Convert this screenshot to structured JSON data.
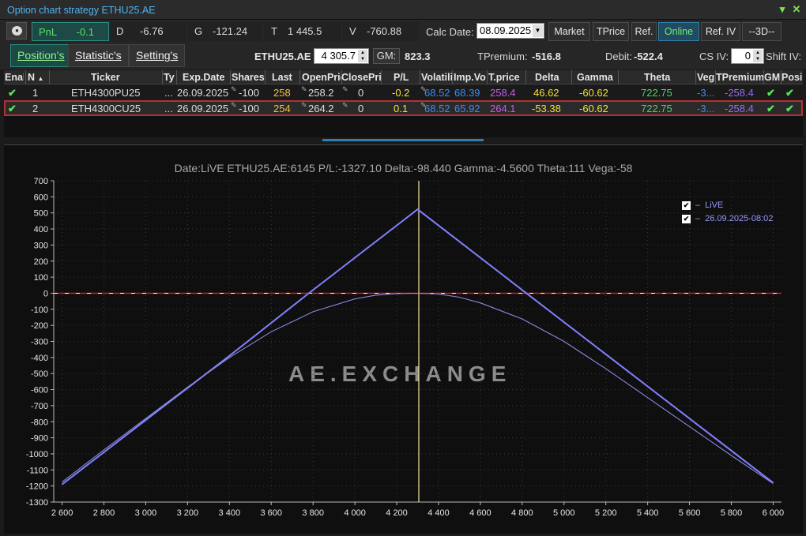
{
  "window": {
    "title": "Option chart strategy ETHU25.AE"
  },
  "row1": {
    "pnl_label": "PnL",
    "pnl_value": "-0.1",
    "d_label": "D",
    "d_value": "-6.76",
    "g_label": "G",
    "g_value": "-121.24",
    "t_label": "T",
    "t_value": "1 445.5",
    "v_label": "V",
    "v_value": "-760.88",
    "calc_label": "Calc Date:",
    "calc_date": "08.09.2025",
    "buttons": [
      "Market",
      "TPrice",
      "Ref.",
      "Online",
      "Ref. IV",
      "--3D--"
    ]
  },
  "row2": {
    "tabs": [
      "Position's",
      "Statistic's",
      "Setting's"
    ],
    "underlying": "ETHU25.AE",
    "underlying_price": "4 305.7",
    "gm_label": "GM:",
    "gm_value": "823.3",
    "tpremium_label": "TPremium:",
    "tpremium_value": "-516.8",
    "debit_label": "Debit:",
    "debit_value": "-522.4",
    "csiv_label": "CS IV:",
    "csiv_value": "0",
    "shiftiv_label": "Shift IV:"
  },
  "grid": {
    "headers": [
      "Enal",
      "N",
      "Ticker",
      "Ty",
      "Exp.Date",
      "Shares",
      "Last",
      "OpenPric",
      "ClosePri",
      "P/L",
      "Volatili",
      "Imp.Vo",
      "T.price",
      "Delta",
      "Gamma",
      "Theta",
      "Veg",
      "TPremium",
      "GM",
      "Posi"
    ],
    "rows": [
      {
        "n": "1",
        "ticker": "ETH4300PU25",
        "ty": "...",
        "exp": "26.09.2025",
        "shares": "-100",
        "last": "258",
        "open": "258.2",
        "close": "0",
        "pl": "-0.2",
        "vol": "68.52",
        "impvol": "68.39",
        "tprice": "258.4",
        "delta": "46.62",
        "gamma": "-60.62",
        "theta": "722.75",
        "vega": "-3...",
        "tpremium": "-258.4"
      },
      {
        "n": "2",
        "ticker": "ETH4300CU25",
        "ty": "...",
        "exp": "26.09.2025",
        "shares": "-100",
        "last": "254",
        "open": "264.2",
        "close": "0",
        "pl": "0.1",
        "vol": "68.52",
        "impvol": "65.92",
        "tprice": "264.1",
        "delta": "-53.38",
        "gamma": "-60.62",
        "theta": "722.75",
        "vega": "-3...",
        "tpremium": "-258.4"
      }
    ]
  },
  "chart": {
    "title": "Date:LiVE  ETHU25.AE:6145  P/L:-1327.10  Delta:-98.440  Gamma:-4.5600  Theta:111  Vega:-58",
    "watermark": "AE.EXCHANGE",
    "legend": [
      "LiVE",
      "26.09.2025-08:02"
    ]
  },
  "chart_data": {
    "type": "line",
    "x_ticks": [
      2600,
      2800,
      3000,
      3200,
      3400,
      3600,
      3800,
      4000,
      4200,
      4400,
      4600,
      4800,
      5000,
      5200,
      5400,
      5600,
      5800,
      6000
    ],
    "y_ticks": [
      700,
      600,
      500,
      400,
      300,
      200,
      100,
      0,
      -100,
      -200,
      -300,
      -400,
      -500,
      -600,
      -700,
      -800,
      -900,
      -1000,
      -1100,
      -1200,
      -1300
    ],
    "xlim": [
      2560,
      6040
    ],
    "ylim": [
      -1300,
      700
    ],
    "strike": 4300,
    "current_price": 4305.7,
    "series": [
      {
        "name": "26.09.2025-08:02",
        "color": "#8080ff",
        "x": [
          2600,
          3000,
          3400,
          3780,
          4300,
          4820,
          5200,
          5600,
          6000
        ],
        "y": [
          -1190,
          -790,
          -390,
          0,
          522,
          0,
          -380,
          -780,
          -1180
        ]
      },
      {
        "name": "LiVE",
        "color": "#8a8ae0",
        "x": [
          2600,
          2800,
          3000,
          3200,
          3400,
          3600,
          3800,
          4000,
          4100,
          4200,
          4300,
          4400,
          4500,
          4600,
          4800,
          5000,
          5200,
          5400,
          5600,
          5800,
          6000
        ],
        "y": [
          -1175,
          -975,
          -780,
          -585,
          -400,
          -240,
          -115,
          -35,
          -12,
          -2,
          0,
          -5,
          -25,
          -60,
          -160,
          -300,
          -470,
          -650,
          -830,
          -1010,
          -1185
        ]
      }
    ]
  },
  "colors": {
    "accent": "#2f8a7f",
    "online": "#6ef082",
    "selected_border": "#b43030"
  }
}
